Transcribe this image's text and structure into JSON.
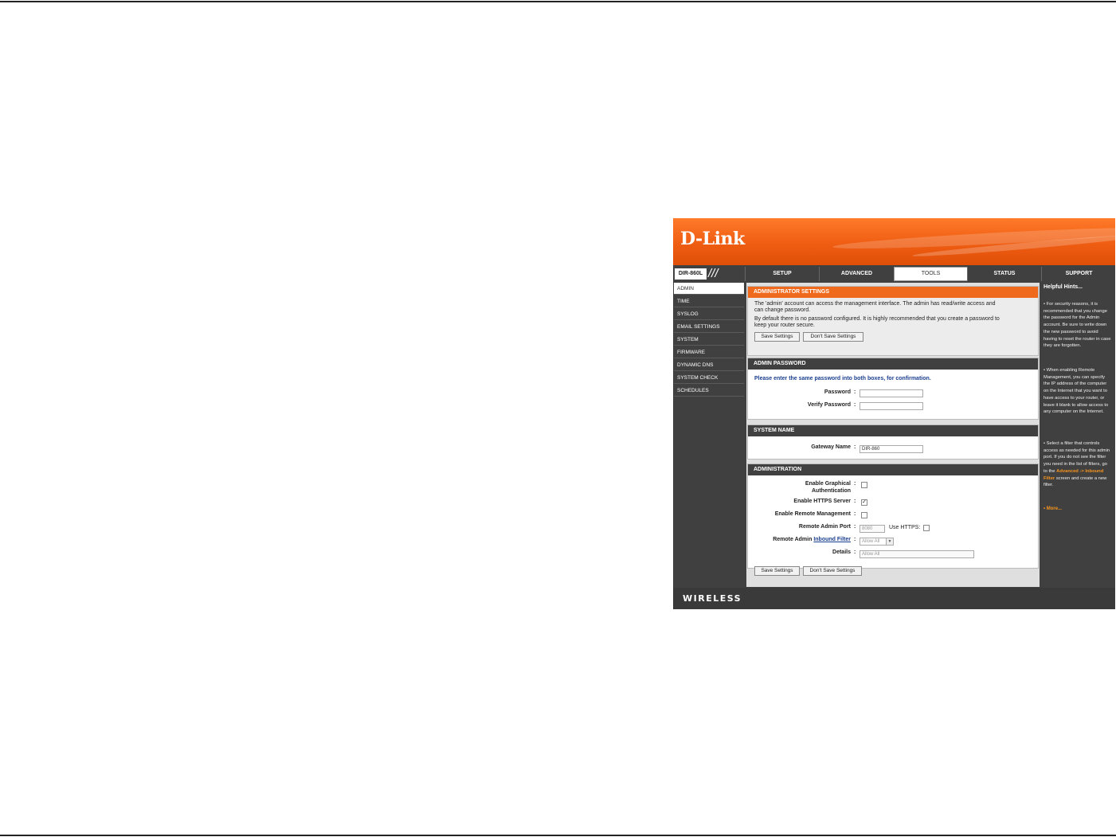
{
  "brand": {
    "logo": "D-Link",
    "model": "DIR-860L",
    "footer": "WIRELESS"
  },
  "nav": {
    "tabs": [
      "SETUP",
      "ADVANCED",
      "TOOLS",
      "STATUS",
      "SUPPORT"
    ],
    "active": "TOOLS"
  },
  "sidebar": {
    "items": [
      "ADMIN",
      "TIME",
      "SYSLOG",
      "EMAIL SETTINGS",
      "SYSTEM",
      "FIRMWARE",
      "DYNAMIC DNS",
      "SYSTEM CHECK",
      "SCHEDULES"
    ],
    "active": "ADMIN"
  },
  "admin_settings": {
    "title": "ADMINISTRATOR SETTINGS",
    "line1": "The 'admin' account can access the management interface. The admin has read/write access and",
    "line2": "can change password.",
    "line3": "By default there is no password configured. It is highly recommended that you create a password to",
    "line4": "keep your router secure.",
    "save": "Save Settings",
    "dont_save": "Don't Save Settings"
  },
  "admin_password": {
    "title": "ADMIN PASSWORD",
    "instruction": "Please enter the same password into both boxes, for confirmation.",
    "password_label": "Password",
    "verify_label": "Verify Password",
    "password_value": "",
    "verify_value": ""
  },
  "system_name": {
    "title": "SYSTEM NAME",
    "gateway_label": "Gateway Name",
    "gateway_value": "DIR-860"
  },
  "administration": {
    "title": "ADMINISTRATION",
    "graphical_auth_label_1": "Enable Graphical",
    "graphical_auth_label_2": "Authentication",
    "graphical_auth_checked": false,
    "https_label": "Enable HTTPS Server",
    "https_checked": true,
    "remote_mgmt_label": "Enable Remote Management",
    "remote_mgmt_checked": false,
    "port_label": "Remote Admin Port",
    "port_value": "8080",
    "use_https_label": "Use HTTPS:",
    "filter_label_prefix": "Remote Admin",
    "filter_link": "Inbound Filter",
    "filter_value": "Allow All",
    "details_label": "Details",
    "details_value": "Allow All"
  },
  "bottom_buttons": {
    "save": "Save Settings",
    "dont_save": "Don't Save Settings"
  },
  "hints": {
    "title": "Helpful Hints...",
    "hint1": "• For security reasons, it is recommended that you change the password for the Admin account. Be sure to write down the new password to avoid having to reset the router in case they are forgotten.",
    "hint2": "• When enabling Remote Management, you can specify the IP address of the computer on the Internet that you want to have access to your router, or leave it blank to allow access to any computer on the Internet.",
    "hint3_pre": "• Select a filter that controls access as needed for this admin port. If you do not see the filter you need in the list of filters, go to the",
    "hint3_link": "Advanced -> Inbound Filter",
    "hint3_post": "screen and create a new filter.",
    "more": "• More..."
  },
  "colors": {
    "orange": "#f06a1d",
    "dark": "#404040",
    "hint_link": "#f7941d"
  }
}
